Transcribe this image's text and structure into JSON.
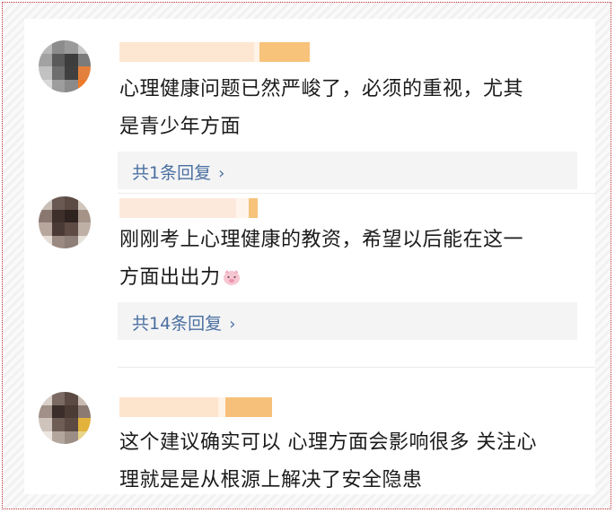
{
  "comments": [
    {
      "text_line1": "心理健康问题已然严峻了，必须的重视，尤其",
      "text_line2": "是青少年方面",
      "reply_label": "共1条回复"
    },
    {
      "text_line1": "刚刚考上心理健康的教资，希望以后能在这一",
      "text_line2": "方面出出力",
      "emoji": "pig-face-emoji",
      "reply_label": "共14条回复"
    },
    {
      "text_line1": "这个建议确实可以 心理方面会影响很多 关注心",
      "text_line2": "理就是是从根源上解决了安全隐患"
    }
  ],
  "icons": {
    "chevron": "chevron-right-icon"
  },
  "colors": {
    "reply_link": "#4a6fa0",
    "reply_bg": "#f4f4f5",
    "username_blur_light": "#fde6cc",
    "username_blur_dark": "#f6c27a"
  }
}
